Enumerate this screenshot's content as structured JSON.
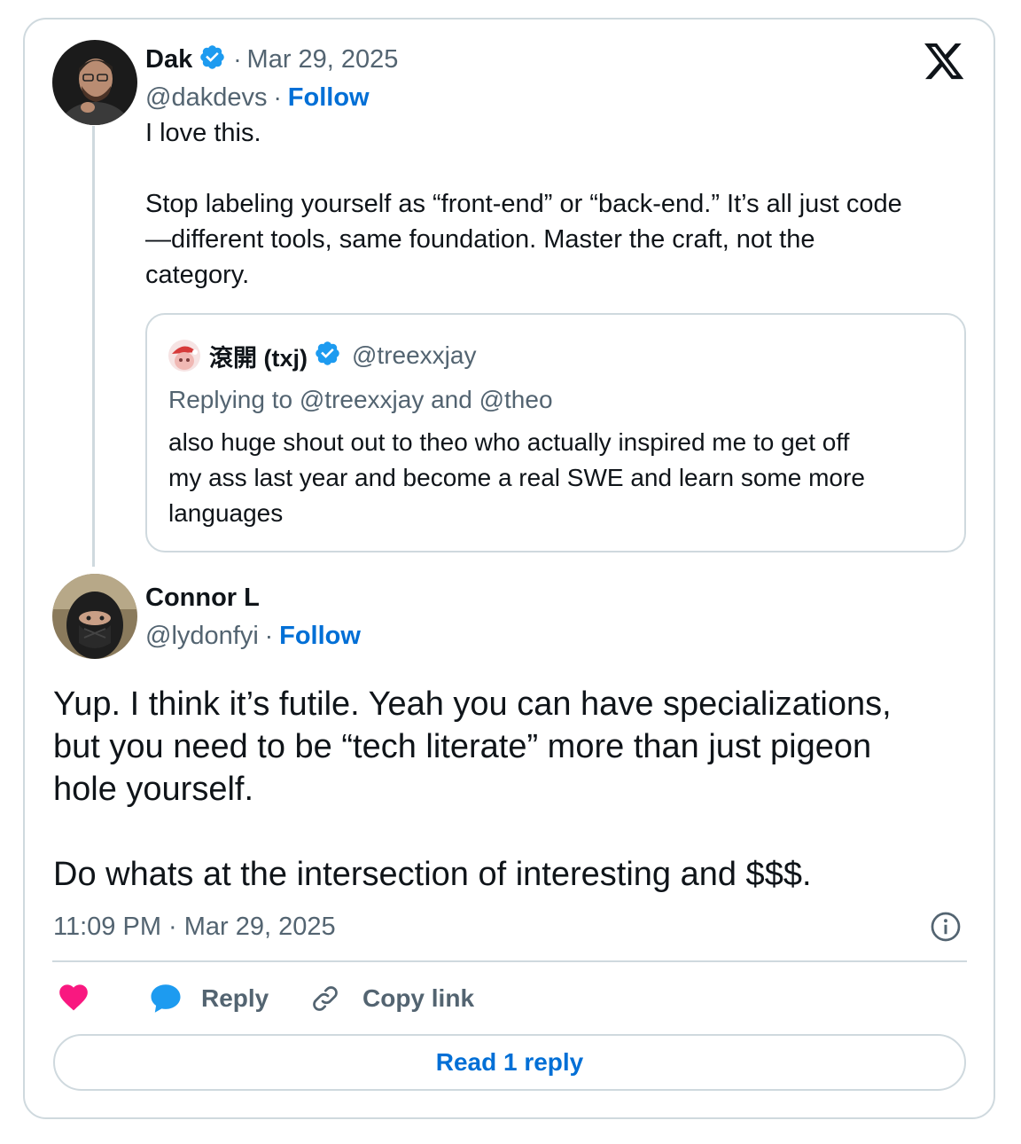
{
  "main_tweet": {
    "author_name": "Dak",
    "date_sep": "·",
    "date": "Mar 29, 2025",
    "handle": "@dakdevs",
    "handle_sep": "·",
    "follow_label": "Follow",
    "text_line1": "I love this.",
    "text_p2_line1": "Stop labeling yourself as “front-end” or “back-end.” It’s all just code",
    "text_p2_line2": "—different tools, same foundation. Master the craft, not the",
    "text_p2_line3": "category."
  },
  "quoted_tweet": {
    "author_name": "滾開 (txj)",
    "handle": "@treexxjay",
    "replying_to": "Replying to @treexxjay and @theo",
    "text_line1": "also huge shout out to theo who actually inspired me to get off",
    "text_line2": "my ass last year and become a real SWE and learn some more",
    "text_line3": "languages"
  },
  "reply_tweet": {
    "author_name": "Connor L",
    "handle": "@lydonfyi",
    "handle_sep": "·",
    "follow_label": "Follow",
    "text_line1": "Yup. I think it’s futile. Yeah you can have specializations,",
    "text_line2": "but you need to be “tech literate” more than just pigeon",
    "text_line3": "hole yourself.",
    "text_line4": "Do whats at the intersection of interesting and $$$.",
    "timestamp": "11:09 PM · Mar 29, 2025"
  },
  "actions": {
    "reply_label": "Reply",
    "copy_link_label": "Copy link",
    "read_replies_label": "Read 1 reply"
  },
  "icons": {
    "brand": "x-logo-icon",
    "verified": "verified-badge-icon",
    "info": "info-icon",
    "like": "heart-icon",
    "reply": "reply-bubble-icon",
    "copy_link": "link-icon"
  },
  "colors": {
    "verified_blue": "#1d9bf0",
    "follow_blue": "#006fd6",
    "like_pink": "#f91880",
    "muted_gray": "#536471",
    "border": "#cfd9de"
  }
}
